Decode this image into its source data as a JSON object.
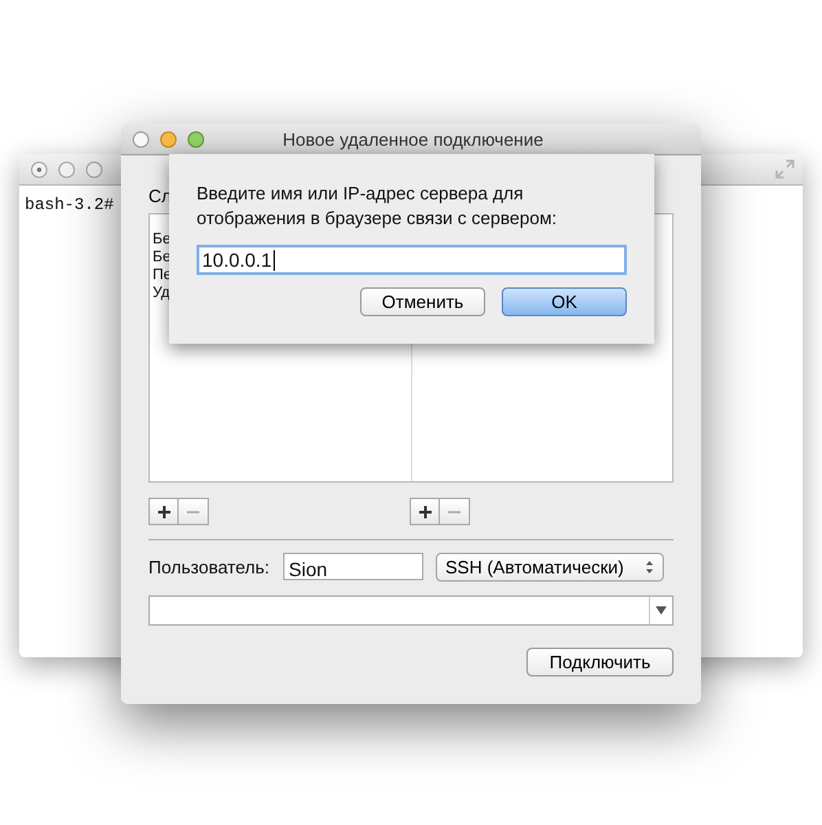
{
  "terminal": {
    "prompt": "bash-3.2#"
  },
  "window": {
    "title": "Новое удаленное подключение",
    "services_label": "Сл",
    "services": [
      "Бе",
      "Бе",
      "Пе",
      "Уд"
    ],
    "user_label": "Пользователь:",
    "user_value": "Sion",
    "protocol": "SSH (Автоматически)",
    "connect_button": "Подключить"
  },
  "sheet": {
    "message": "Введите имя или IP-адрес сервера для отображения в браузере связи с сервером:",
    "value": "10.0.0.1",
    "buttons": [
      {
        "label": "Отменить",
        "default": false
      },
      {
        "label": "OK",
        "default": true
      }
    ]
  }
}
